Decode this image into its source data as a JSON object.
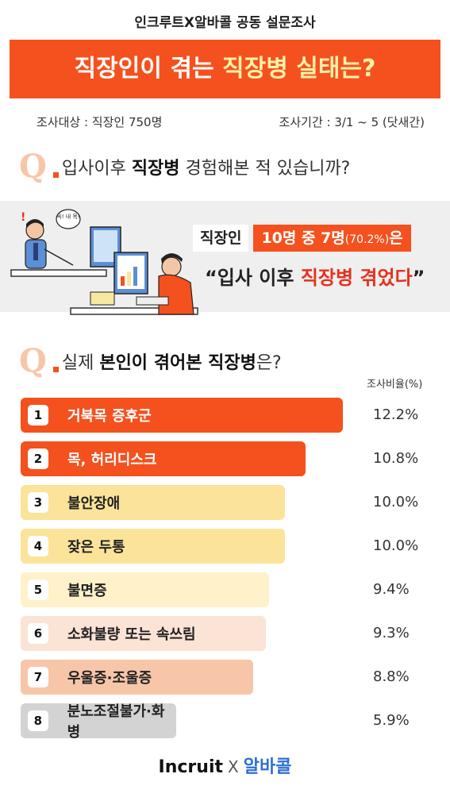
{
  "header": {
    "subtitle": "인크루트X알바콜  공동 설문조사",
    "title_part1": "직장인이 겪는 ",
    "title_highlight": "직장병 실태는?"
  },
  "meta": {
    "target": "조사대상 : 직장인 750명",
    "period": "조사기간 : 3/1 ~ 5 (닷새간)"
  },
  "q1": {
    "mark": "Q",
    "text_before": "입사이후 ",
    "text_bold": "직장병",
    "text_after": " 경험해본 적 있습니까?"
  },
  "result": {
    "label": "직장인",
    "box_main": "10명 중 7명",
    "box_pct": "(70.2%)",
    "box_tail": "은",
    "quote_before": "“입사 이후 ",
    "quote_red": "직장병 겪었다",
    "quote_after": "”",
    "speech_bubble": "윽! 내 목!"
  },
  "q2": {
    "mark": "Q",
    "text_before": "실제 ",
    "text_bold": "본인이 겪어본 직장병",
    "text_after": "은?"
  },
  "chart_data": {
    "type": "bar",
    "orientation": "horizontal",
    "column_header": "조사비율(%)",
    "categories": [
      "거북목 증후군",
      "목, 허리디스크",
      "불안장애",
      "잦은 두통",
      "불면증",
      "소화불량 또는 속쓰림",
      "우울증·조울증",
      "분노조절불가·화병"
    ],
    "values": [
      12.2,
      10.8,
      10.0,
      10.0,
      9.4,
      9.3,
      8.8,
      5.9
    ],
    "value_labels": [
      "12.2%",
      "10.8%",
      "10.0%",
      "10.0%",
      "9.4%",
      "9.3%",
      "8.8%",
      "5.9%"
    ],
    "ranks": [
      "1",
      "2",
      "3",
      "4",
      "5",
      "6",
      "7",
      "8"
    ],
    "colors": [
      "#f4511e",
      "#f4511e",
      "#fbe39a",
      "#fbe39a",
      "#fff1c9",
      "#fbe3d6",
      "#f7c6a9",
      "#d3d3d3"
    ],
    "label_colors": [
      "#ffffff",
      "#ffffff",
      "#222222",
      "#222222",
      "#222222",
      "#222222",
      "#222222",
      "#222222"
    ]
  },
  "footer": {
    "brand1": "Incruit",
    "separator": "X",
    "brand2": "알바콜"
  }
}
